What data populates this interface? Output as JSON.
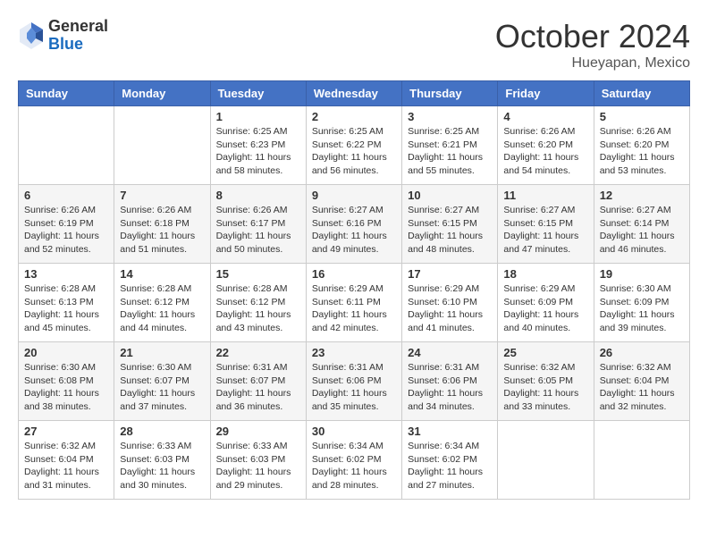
{
  "header": {
    "logo_line1": "General",
    "logo_line2": "Blue",
    "month": "October 2024",
    "location": "Hueyapan, Mexico"
  },
  "days_of_week": [
    "Sunday",
    "Monday",
    "Tuesday",
    "Wednesday",
    "Thursday",
    "Friday",
    "Saturday"
  ],
  "weeks": [
    [
      null,
      null,
      {
        "day": 1,
        "sunrise": "6:25 AM",
        "sunset": "6:23 PM",
        "daylight": "11 hours and 58 minutes."
      },
      {
        "day": 2,
        "sunrise": "6:25 AM",
        "sunset": "6:22 PM",
        "daylight": "11 hours and 56 minutes."
      },
      {
        "day": 3,
        "sunrise": "6:25 AM",
        "sunset": "6:21 PM",
        "daylight": "11 hours and 55 minutes."
      },
      {
        "day": 4,
        "sunrise": "6:26 AM",
        "sunset": "6:20 PM",
        "daylight": "11 hours and 54 minutes."
      },
      {
        "day": 5,
        "sunrise": "6:26 AM",
        "sunset": "6:20 PM",
        "daylight": "11 hours and 53 minutes."
      }
    ],
    [
      {
        "day": 6,
        "sunrise": "6:26 AM",
        "sunset": "6:19 PM",
        "daylight": "11 hours and 52 minutes."
      },
      {
        "day": 7,
        "sunrise": "6:26 AM",
        "sunset": "6:18 PM",
        "daylight": "11 hours and 51 minutes."
      },
      {
        "day": 8,
        "sunrise": "6:26 AM",
        "sunset": "6:17 PM",
        "daylight": "11 hours and 50 minutes."
      },
      {
        "day": 9,
        "sunrise": "6:27 AM",
        "sunset": "6:16 PM",
        "daylight": "11 hours and 49 minutes."
      },
      {
        "day": 10,
        "sunrise": "6:27 AM",
        "sunset": "6:15 PM",
        "daylight": "11 hours and 48 minutes."
      },
      {
        "day": 11,
        "sunrise": "6:27 AM",
        "sunset": "6:15 PM",
        "daylight": "11 hours and 47 minutes."
      },
      {
        "day": 12,
        "sunrise": "6:27 AM",
        "sunset": "6:14 PM",
        "daylight": "11 hours and 46 minutes."
      }
    ],
    [
      {
        "day": 13,
        "sunrise": "6:28 AM",
        "sunset": "6:13 PM",
        "daylight": "11 hours and 45 minutes."
      },
      {
        "day": 14,
        "sunrise": "6:28 AM",
        "sunset": "6:12 PM",
        "daylight": "11 hours and 44 minutes."
      },
      {
        "day": 15,
        "sunrise": "6:28 AM",
        "sunset": "6:12 PM",
        "daylight": "11 hours and 43 minutes."
      },
      {
        "day": 16,
        "sunrise": "6:29 AM",
        "sunset": "6:11 PM",
        "daylight": "11 hours and 42 minutes."
      },
      {
        "day": 17,
        "sunrise": "6:29 AM",
        "sunset": "6:10 PM",
        "daylight": "11 hours and 41 minutes."
      },
      {
        "day": 18,
        "sunrise": "6:29 AM",
        "sunset": "6:09 PM",
        "daylight": "11 hours and 40 minutes."
      },
      {
        "day": 19,
        "sunrise": "6:30 AM",
        "sunset": "6:09 PM",
        "daylight": "11 hours and 39 minutes."
      }
    ],
    [
      {
        "day": 20,
        "sunrise": "6:30 AM",
        "sunset": "6:08 PM",
        "daylight": "11 hours and 38 minutes."
      },
      {
        "day": 21,
        "sunrise": "6:30 AM",
        "sunset": "6:07 PM",
        "daylight": "11 hours and 37 minutes."
      },
      {
        "day": 22,
        "sunrise": "6:31 AM",
        "sunset": "6:07 PM",
        "daylight": "11 hours and 36 minutes."
      },
      {
        "day": 23,
        "sunrise": "6:31 AM",
        "sunset": "6:06 PM",
        "daylight": "11 hours and 35 minutes."
      },
      {
        "day": 24,
        "sunrise": "6:31 AM",
        "sunset": "6:06 PM",
        "daylight": "11 hours and 34 minutes."
      },
      {
        "day": 25,
        "sunrise": "6:32 AM",
        "sunset": "6:05 PM",
        "daylight": "11 hours and 33 minutes."
      },
      {
        "day": 26,
        "sunrise": "6:32 AM",
        "sunset": "6:04 PM",
        "daylight": "11 hours and 32 minutes."
      }
    ],
    [
      {
        "day": 27,
        "sunrise": "6:32 AM",
        "sunset": "6:04 PM",
        "daylight": "11 hours and 31 minutes."
      },
      {
        "day": 28,
        "sunrise": "6:33 AM",
        "sunset": "6:03 PM",
        "daylight": "11 hours and 30 minutes."
      },
      {
        "day": 29,
        "sunrise": "6:33 AM",
        "sunset": "6:03 PM",
        "daylight": "11 hours and 29 minutes."
      },
      {
        "day": 30,
        "sunrise": "6:34 AM",
        "sunset": "6:02 PM",
        "daylight": "11 hours and 28 minutes."
      },
      {
        "day": 31,
        "sunrise": "6:34 AM",
        "sunset": "6:02 PM",
        "daylight": "11 hours and 27 minutes."
      },
      null,
      null
    ]
  ]
}
